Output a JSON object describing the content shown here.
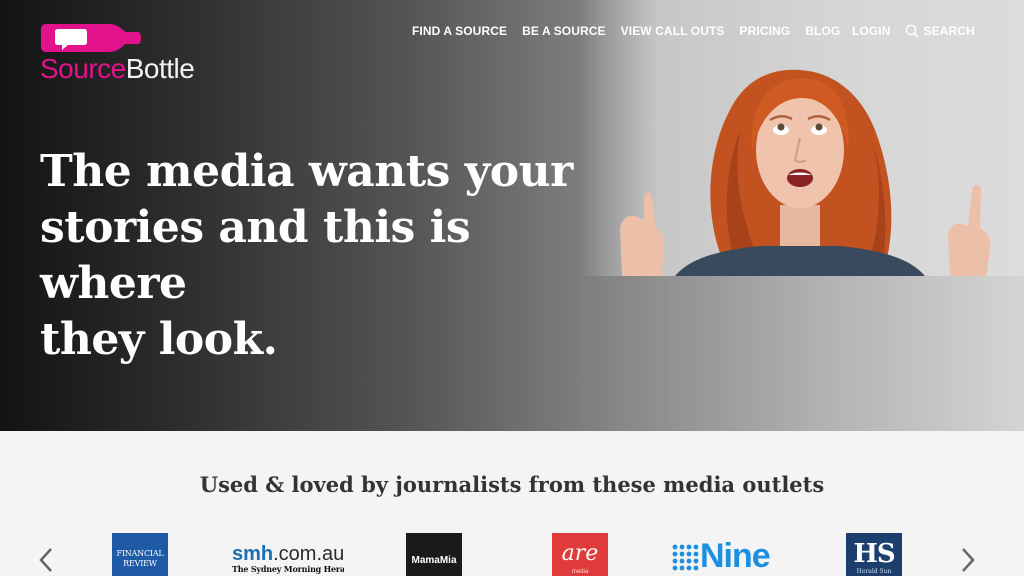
{
  "brand": {
    "name_part1": "Source",
    "name_part2": "Bottle",
    "accent_color": "#e2128d"
  },
  "nav": {
    "items": [
      {
        "label": "FIND A SOURCE"
      },
      {
        "label": "BE A SOURCE"
      },
      {
        "label": "VIEW CALL OUTS"
      },
      {
        "label": "PRICING"
      },
      {
        "label": "BLOG"
      }
    ],
    "login_label": "LOGIN",
    "search_label": "SEARCH",
    "search_icon": "search-icon"
  },
  "hero": {
    "headline_line1": "The media wants your",
    "headline_line2": "stories and this is where",
    "headline_line3": "they look."
  },
  "outlets": {
    "title": "Used & loved by journalists from these media outlets",
    "prev_icon": "chevron-left-icon",
    "next_icon": "chevron-right-icon",
    "logos": {
      "fr_line1": "FINANCIAL",
      "fr_line2": "REVIEW",
      "smh_main": "smh",
      "smh_domain": ".com.au",
      "smh_sub": "The Sydney Morning Herald",
      "mamamia": "MamaMia",
      "are": "are",
      "are_sub": "media",
      "nine": "Nine",
      "hs": "HS",
      "hs_sub": "Herald Sun"
    }
  }
}
